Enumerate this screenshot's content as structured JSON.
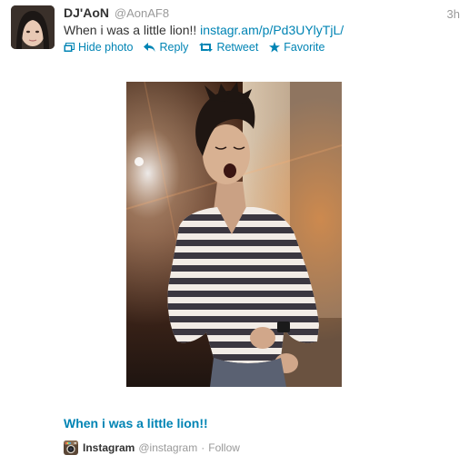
{
  "tweet": {
    "display_name": "DJ'AoN",
    "handle": "@AonAF8",
    "timestamp": "3h",
    "text": "When i was a little lion!! ",
    "link_text": "instagr.am/p/Pd3UYlyTjL/"
  },
  "actions": {
    "hide_photo": "Hide photo",
    "reply": "Reply",
    "retweet": "Retweet",
    "favorite": "Favorite"
  },
  "card": {
    "title": "When i was a little lion!!",
    "source_name": "Instagram",
    "source_handle": "@instagram",
    "separator": "·",
    "follow_label": "Follow"
  },
  "colors": {
    "link": "#0084b4",
    "muted": "#999999",
    "text": "#333333"
  },
  "icons": {
    "hide_photo": "photo-icon",
    "reply": "reply-arrow-icon",
    "retweet": "retweet-icon",
    "favorite": "star-icon",
    "source": "instagram-logo-icon"
  }
}
